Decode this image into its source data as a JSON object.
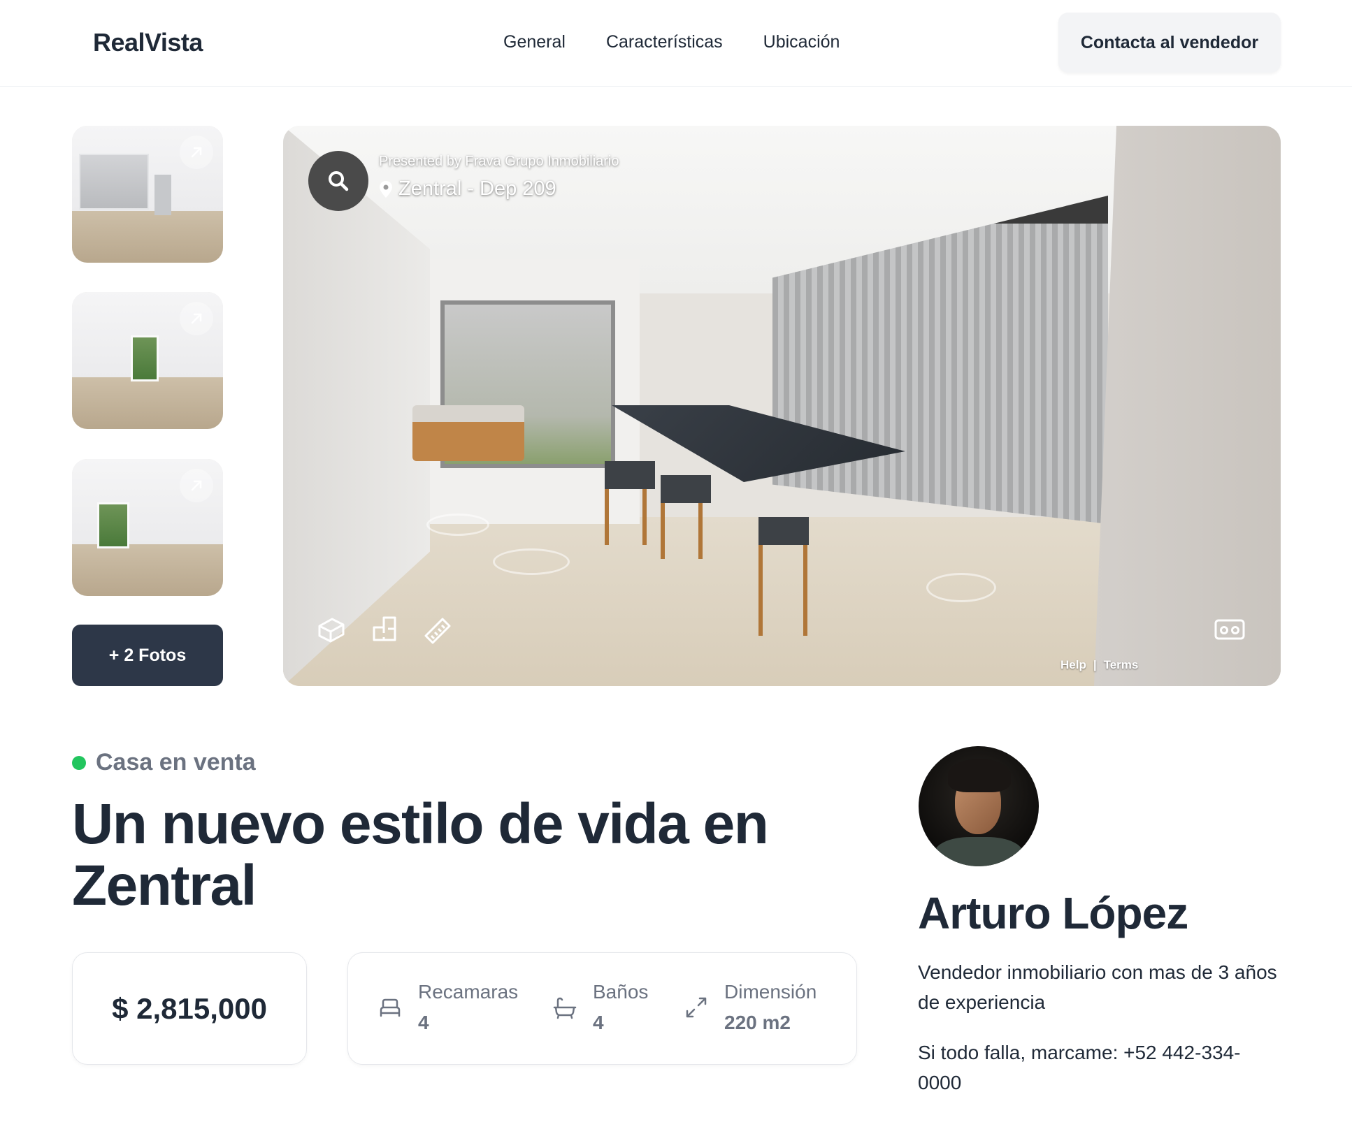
{
  "header": {
    "logo": "RealVista",
    "nav": [
      "General",
      "Características",
      "Ubicación"
    ],
    "contact_button": "Contacta al vendedor"
  },
  "gallery": {
    "thumbnails": [
      "kitchen-photo",
      "living-room-photo",
      "bedroom-photo"
    ],
    "more_photos_label": "+ 2 Fotos"
  },
  "viewer": {
    "presented_by": "Presented by Frava Grupo Inmobiliario",
    "title": "Zentral - Dep 209",
    "help_link": "Help",
    "separator": "|",
    "terms_link": "Terms",
    "icons": [
      "search-icon",
      "dollhouse-icon",
      "floorplan-icon",
      "measure-icon",
      "vr-icon"
    ]
  },
  "listing": {
    "status": "Casa en venta",
    "status_color": "#22c55e",
    "headline": "Un nuevo estilo de vida en Zentral",
    "price": "$ 2,815,000",
    "stats": [
      {
        "label": "Recamaras",
        "value": "4",
        "icon": "bed-icon"
      },
      {
        "label": "Baños",
        "value": "4",
        "icon": "bathtub-icon"
      },
      {
        "label": "Dimensión",
        "value": "220 m2",
        "icon": "expand-icon"
      }
    ]
  },
  "seller": {
    "name": "Arturo López",
    "description": "Vendedor inmobiliario con mas de 3 años de experiencia",
    "phone_text": "Si todo falla, marcame: +52 442-334-0000"
  }
}
